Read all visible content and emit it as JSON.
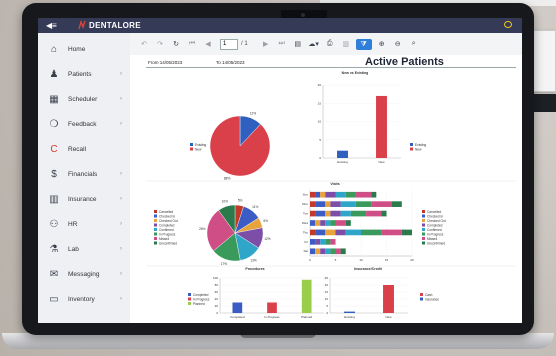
{
  "background": {
    "paper_text": "48509",
    "paper_text2": "4"
  },
  "app": {
    "brand": "DENTALORE",
    "menu_icon": "hamburger-icon"
  },
  "sidebar": {
    "items": [
      {
        "label": "Home",
        "icon": "home-icon",
        "chevron": ""
      },
      {
        "label": "Patients",
        "icon": "person-icon",
        "chevron": "›"
      },
      {
        "label": "Scheduler",
        "icon": "calendar-icon",
        "chevron": "›"
      },
      {
        "label": "Feedback",
        "icon": "chat-bubbles-icon",
        "chevron": "›"
      },
      {
        "label": "Recall",
        "icon": "recall-icon",
        "chevron": ""
      },
      {
        "label": "Financials",
        "icon": "dollar-icon",
        "chevron": "›"
      },
      {
        "label": "Insurance",
        "icon": "building-icon",
        "chevron": "›"
      },
      {
        "label": "HR",
        "icon": "group-icon",
        "chevron": "›"
      },
      {
        "label": "Lab",
        "icon": "flask-icon",
        "chevron": "›"
      },
      {
        "label": "Messaging",
        "icon": "envelope-icon",
        "chevron": "›"
      },
      {
        "label": "Inventory",
        "icon": "box-icon",
        "chevron": "›"
      }
    ]
  },
  "toolbar": {
    "page_value": "1",
    "page_total": "/ 1"
  },
  "report": {
    "title": "Active Patients",
    "from": "From  14/05/2023",
    "to": "To  14/05/2023",
    "colors": {
      "existing": "#2f5fbf",
      "new": "#d9404a"
    }
  },
  "chart_data": [
    {
      "type": "pie",
      "title": "",
      "categories": [
        "Existing",
        "New"
      ],
      "values": [
        12,
        88
      ],
      "labels": [
        "12%",
        "88%"
      ]
    },
    {
      "type": "bar",
      "title": "New vs Existing",
      "categories": [
        "Existing",
        "New"
      ],
      "values": [
        2,
        17
      ],
      "ylim": [
        0,
        20
      ],
      "yticks": [
        "0",
        "5",
        "10",
        "15",
        "20"
      ],
      "legend": [
        "Existing",
        "New"
      ]
    },
    {
      "type": "pie",
      "title": "",
      "categories": [
        "Cancelled",
        "Checked In",
        "Checked Out",
        "Completed",
        "Confirmed",
        "In Progress",
        "Missed",
        "Unconfirmed"
      ],
      "values": [
        5,
        11,
        6,
        12,
        13,
        17,
        26,
        10
      ],
      "labels": [
        "5%",
        "11%",
        "6%",
        "12%",
        "13%",
        "17%",
        "26%",
        "10%"
      ]
    },
    {
      "type": "bar",
      "title": "Visits",
      "orientation": "horizontal",
      "categories": [
        "Sun",
        "Mon",
        "Tue",
        "Wed",
        "Thu",
        "Fri",
        "Sat"
      ],
      "xticks": [
        "0",
        "5",
        "10",
        "15",
        "20"
      ],
      "xlim": [
        0,
        20
      ],
      "legend": [
        "Cancelled",
        "Checked In",
        "Checked Out",
        "Completed",
        "Confirmed",
        "In Progress",
        "Missed",
        "Unconfirmed"
      ],
      "series": [
        {
          "name": "Cancelled",
          "values": [
            1,
            1,
            1,
            0,
            1,
            0,
            0
          ]
        },
        {
          "name": "Checked In",
          "values": [
            1,
            2,
            2,
            1,
            2,
            1,
            1
          ]
        },
        {
          "name": "Checked Out",
          "values": [
            1,
            1,
            1,
            1,
            2,
            0,
            1
          ]
        },
        {
          "name": "Completed",
          "values": [
            2,
            2,
            2,
            1,
            2,
            1,
            1
          ]
        },
        {
          "name": "Confirmed",
          "values": [
            2,
            3,
            2,
            1,
            3,
            1,
            1
          ]
        },
        {
          "name": "In Progress",
          "values": [
            2,
            3,
            3,
            1,
            4,
            1,
            1
          ]
        },
        {
          "name": "Missed",
          "values": [
            3,
            4,
            3,
            2,
            4,
            1,
            1
          ]
        },
        {
          "name": "Unconfirmed",
          "values": [
            1,
            2,
            1,
            1,
            2,
            0,
            1
          ]
        }
      ]
    },
    {
      "type": "bar",
      "title": "Procedures",
      "categories": [
        "Completed",
        "In Progress",
        "Planned"
      ],
      "values": [
        30,
        30,
        95
      ],
      "ylim": [
        0,
        100
      ],
      "yticks": [
        "0",
        "20",
        "40",
        "60",
        "80",
        "100"
      ],
      "legend": [
        "Completed",
        "In Progress",
        "Planned"
      ]
    },
    {
      "type": "bar",
      "title": "Insurance/Credit",
      "categories": [
        "Existing",
        "New"
      ],
      "values": [
        1,
        20
      ],
      "ylim": [
        0,
        25
      ],
      "yticks": [
        "0",
        "5",
        "10",
        "15",
        "20",
        "25"
      ],
      "legend": [
        "Cash",
        "Insurance"
      ]
    }
  ]
}
